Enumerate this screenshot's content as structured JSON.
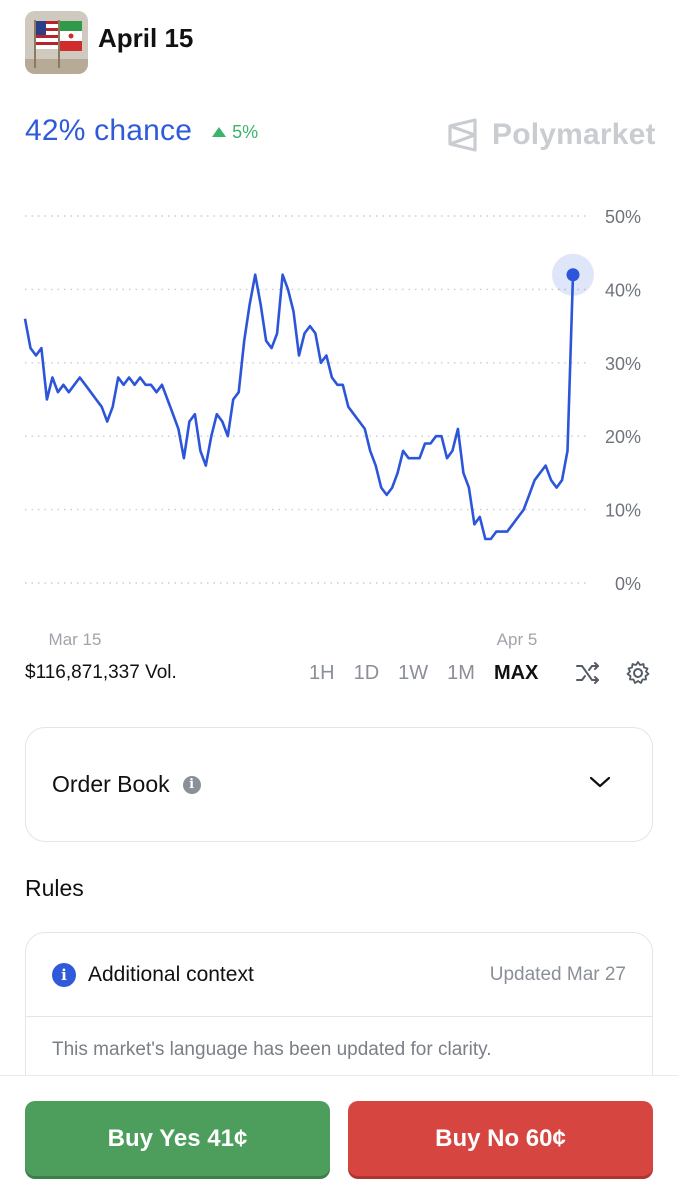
{
  "header": {
    "title": "April 15",
    "thumbnail_icon": "flags-thumbnail"
  },
  "summary": {
    "chance": "42% chance",
    "delta": "5%",
    "delta_icon": "triangle-up-icon",
    "brand": "Polymarket",
    "brand_icon": "polymarket-logo-icon"
  },
  "chart_data": {
    "type": "line",
    "title": "",
    "xlabel": "",
    "ylabel": "",
    "ylim": [
      0,
      50
    ],
    "y_ticks": [
      "50%",
      "40%",
      "30%",
      "20%",
      "10%",
      "0%"
    ],
    "x_ticks": [
      "Mar 15",
      "Apr 5"
    ],
    "grid": "horizontal-dotted",
    "series": [
      {
        "color": "#2d55d9",
        "values": [
          36,
          32,
          31,
          32,
          25,
          28,
          26,
          27,
          26,
          27,
          28,
          27,
          26,
          25,
          24,
          22,
          24,
          28,
          27,
          28,
          27,
          28,
          27,
          27,
          26,
          27,
          25,
          23,
          21,
          17,
          22,
          23,
          18,
          16,
          20,
          23,
          22,
          20,
          25,
          26,
          33,
          38,
          42,
          38,
          33,
          32,
          34,
          42,
          40,
          37,
          31,
          34,
          35,
          34,
          30,
          31,
          28,
          27,
          27,
          24,
          23,
          22,
          21,
          18,
          16,
          13,
          12,
          13,
          15,
          18,
          17,
          17,
          17,
          19,
          19,
          20,
          20,
          17,
          18,
          21,
          15,
          13,
          8,
          9,
          6,
          6,
          7,
          7,
          7,
          8,
          9,
          10,
          12,
          14,
          15,
          16,
          14,
          13,
          14,
          18,
          42
        ]
      }
    ],
    "last_value": 42
  },
  "controls": {
    "volume": "$116,871,337 Vol.",
    "ranges": [
      "1H",
      "1D",
      "1W",
      "1M",
      "MAX"
    ],
    "active_range": "MAX",
    "shuffle_icon": "shuffle-icon",
    "settings_icon": "gear-icon"
  },
  "order_book": {
    "label": "Order Book",
    "info_icon": "info-icon",
    "chevron_icon": "chevron-down-icon"
  },
  "rules": {
    "heading": "Rules"
  },
  "context": {
    "title": "Additional context",
    "updated": "Updated Mar 27",
    "body": "This market's language has been updated for clarity."
  },
  "actions": {
    "buy_yes": "Buy Yes 41¢",
    "buy_no": "Buy No 60¢",
    "yes_color": "#4d9e5c",
    "no_color": "#d6453f"
  },
  "colors": {
    "accent": "#2f5bd8",
    "positive": "#3bb56a",
    "muted": "#8a8f98"
  }
}
